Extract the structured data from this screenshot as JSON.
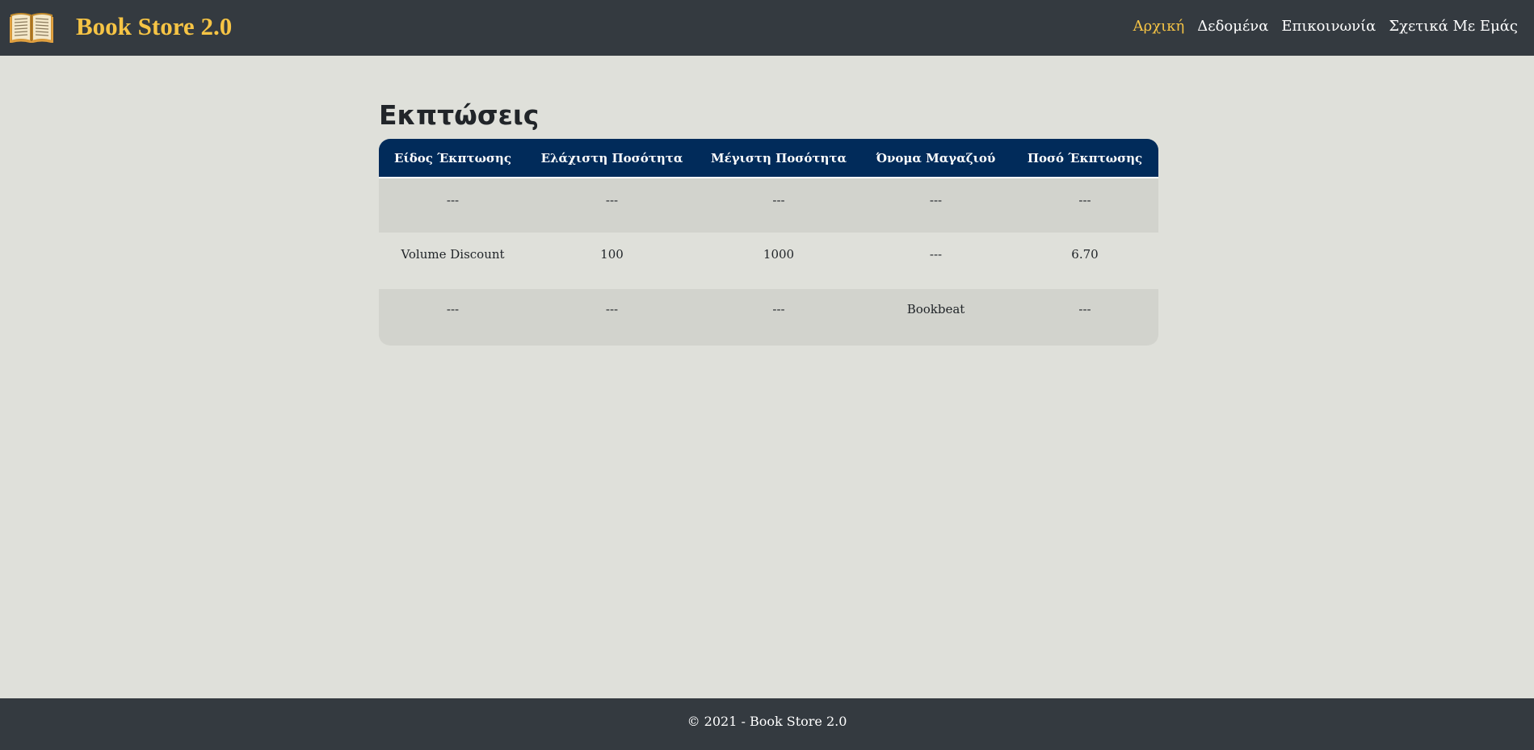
{
  "navbar": {
    "logo_icon": "open-book-icon",
    "brand": "Book Store 2.0",
    "links": [
      {
        "label": "Αρχική",
        "active": true
      },
      {
        "label": "Δεδομένα",
        "active": false
      },
      {
        "label": "Επικοινωνία",
        "active": false
      },
      {
        "label": "Σχετικά Με Εμάς",
        "active": false
      }
    ],
    "colors": {
      "background": "#343a40",
      "accent": "#f6c445"
    }
  },
  "main": {
    "title": "Εκπτώσεις",
    "table": {
      "headers": [
        "Είδος Έκπτωσης",
        "Ελάχιστη Ποσότητα",
        "Μέγιστη Ποσότητα",
        "Όνομα Μαγαζιού",
        "Ποσό Έκπτωσης"
      ],
      "rows": [
        [
          "---",
          "---",
          "---",
          "---",
          "---"
        ],
        [
          "Volume Discount",
          "100",
          "1000",
          "---",
          "6.70"
        ],
        [
          "---",
          "---",
          "---",
          "Bookbeat",
          "---"
        ]
      ],
      "header_color": "#012b5a"
    }
  },
  "footer": {
    "text": "© 2021 - Book Store 2.0"
  }
}
